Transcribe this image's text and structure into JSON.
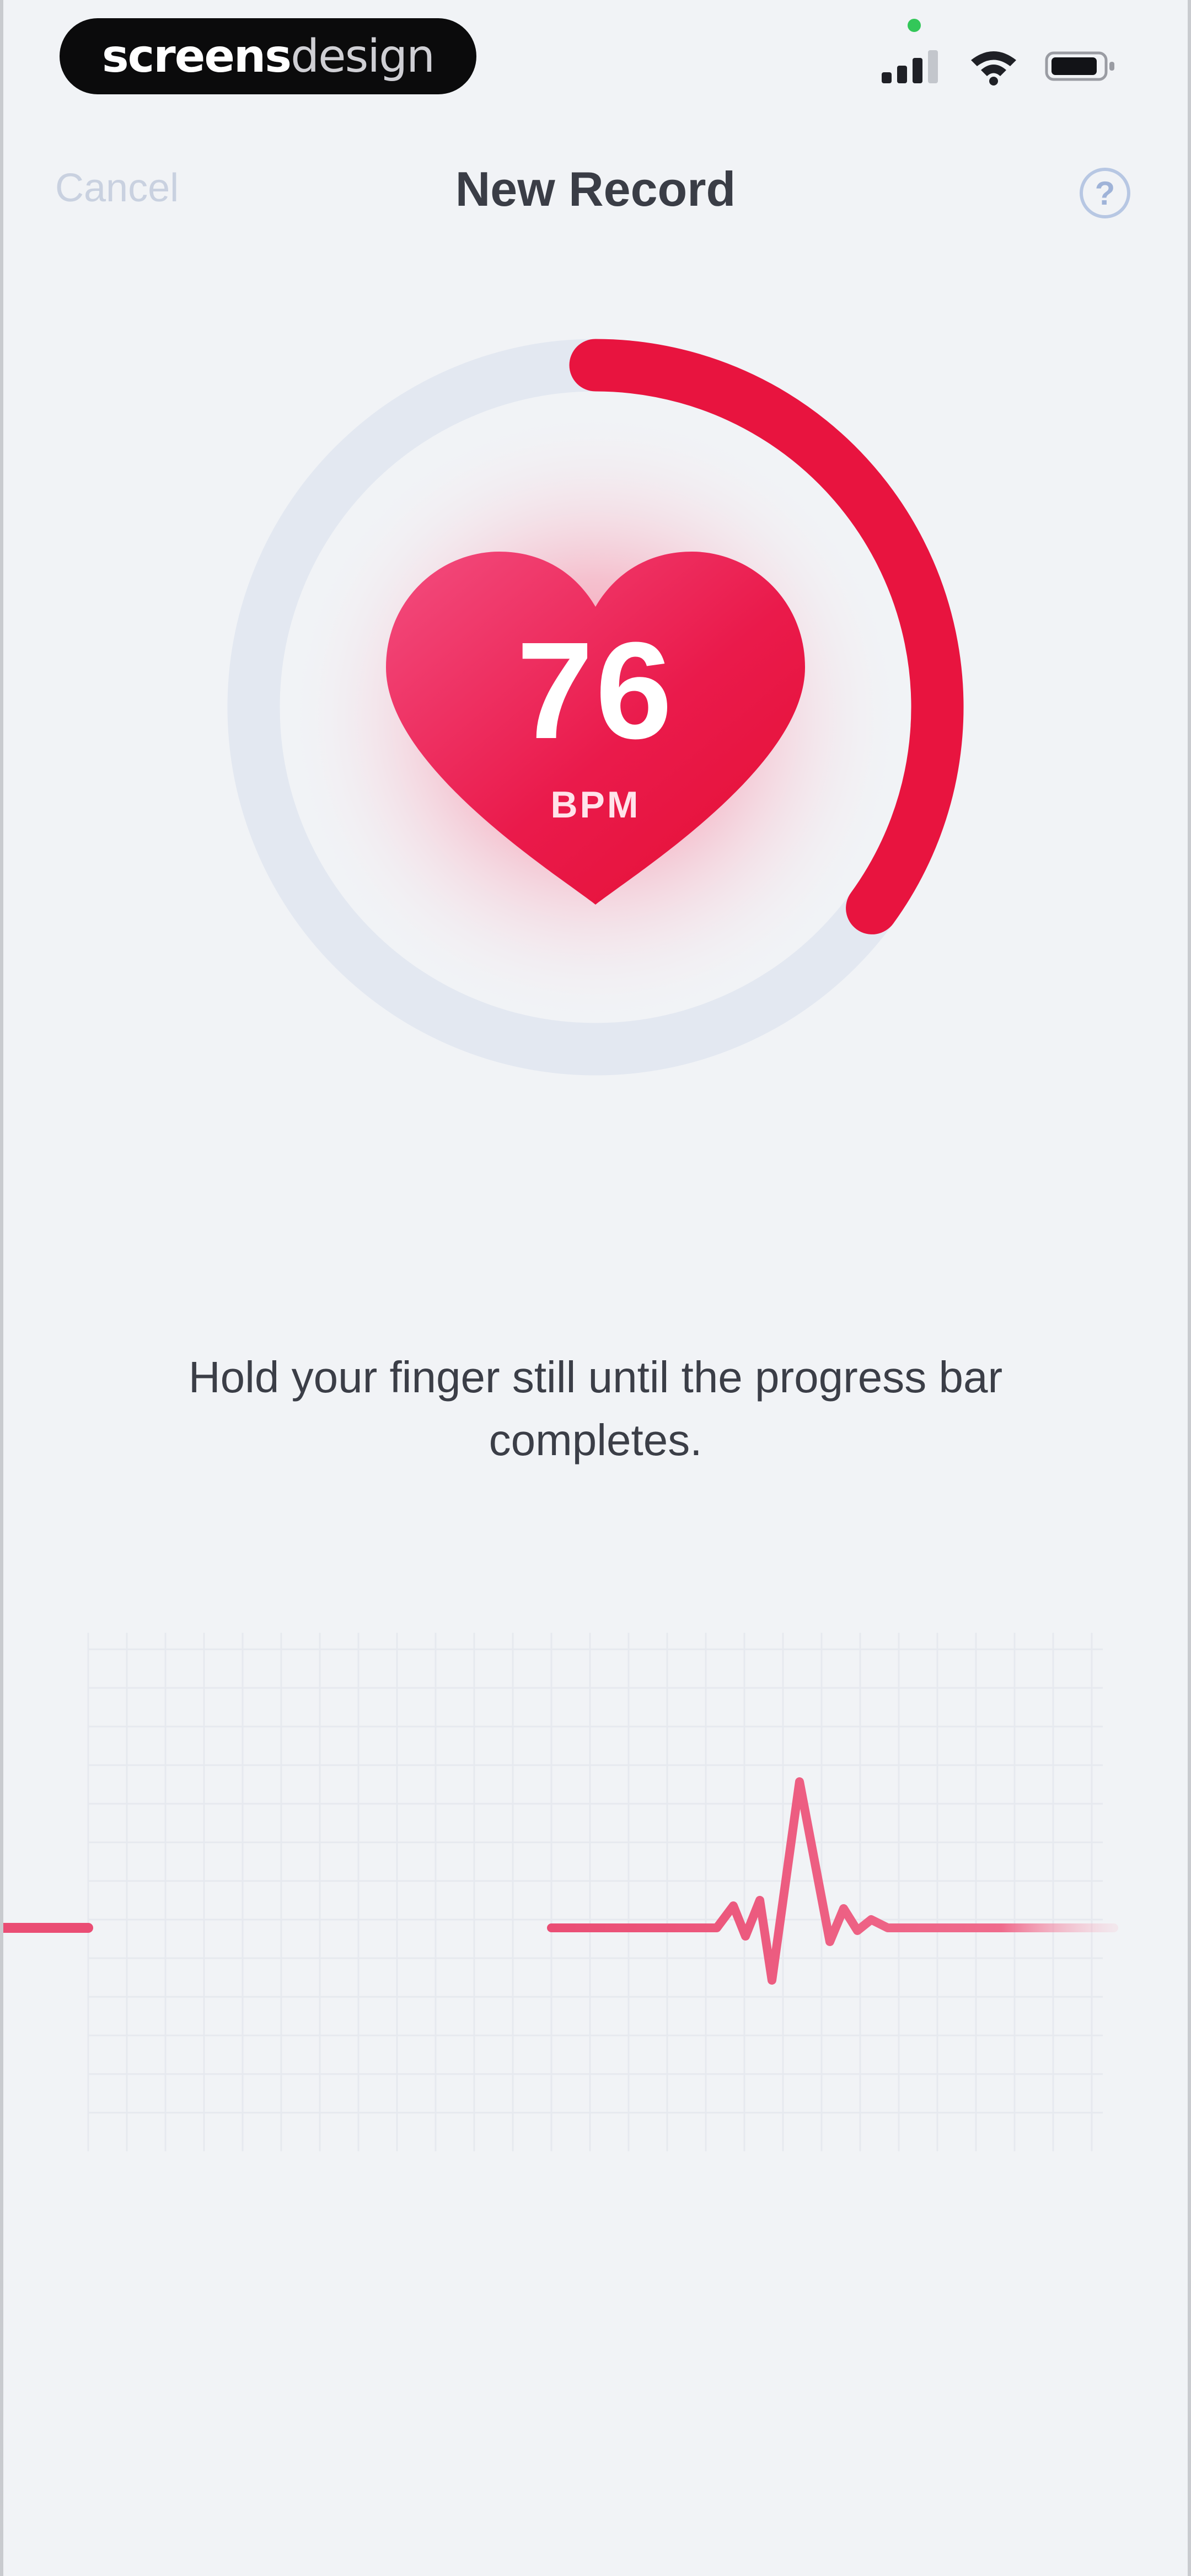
{
  "status_bar": {
    "brand_bold": "screens",
    "brand_light": "design",
    "signal_icon": "cellular-signal-icon",
    "wifi_icon": "wifi-icon",
    "battery_icon": "battery-icon"
  },
  "nav": {
    "cancel_label": "Cancel",
    "title": "New Record",
    "help_label": "?",
    "help_icon": "help-circle-icon"
  },
  "measurement": {
    "bpm_value": "76",
    "bpm_unit": "BPM",
    "progress_fraction": 0.35,
    "heart_icon": "heart-icon"
  },
  "instruction": {
    "text": "Hold your finger still until the progress bar completes."
  },
  "colors": {
    "accent_red": "#e8143f",
    "ring_track": "#e3e8f1",
    "background": "#f1f3f6",
    "title_text": "#3a3d46"
  }
}
